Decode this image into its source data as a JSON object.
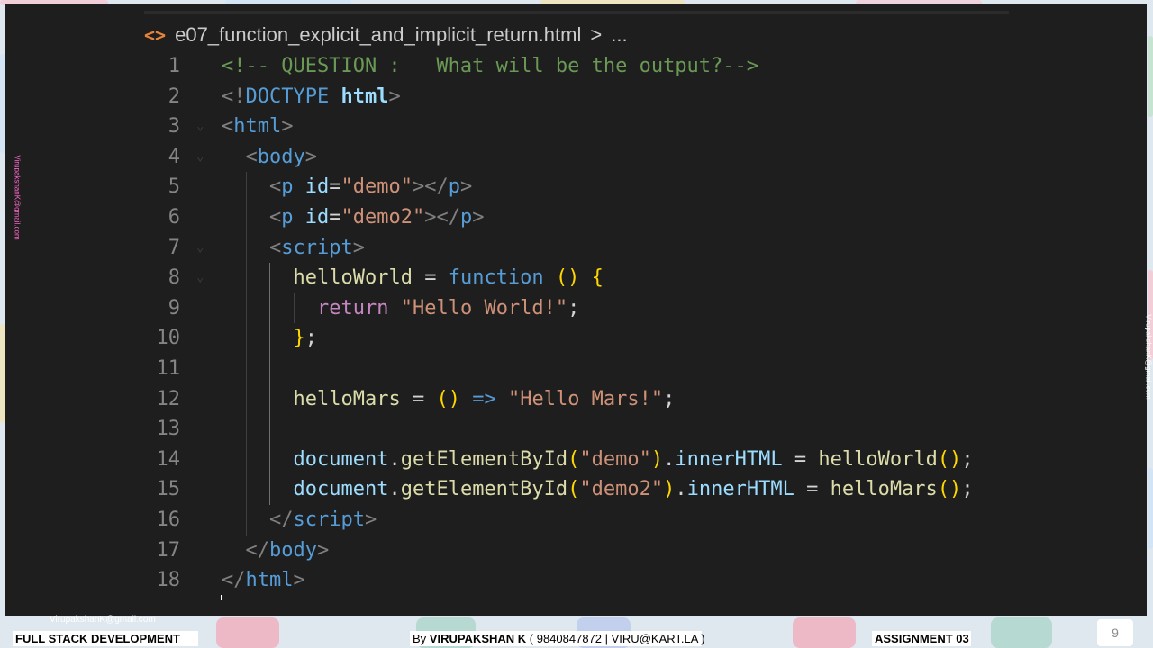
{
  "tab": {
    "file_icon": "<>",
    "filename": "e07_function_explicit_and_implicit_return.html",
    "breadcrumb_sep": ">",
    "breadcrumb_more": "..."
  },
  "editor": {
    "lines": [
      {
        "n": "1",
        "tokens": [
          [
            "t-comment",
            "<!-- QUESTION :   What will be the output?-->"
          ]
        ]
      },
      {
        "n": "2",
        "tokens": [
          [
            "t-punc",
            "<!"
          ],
          [
            "t-tag",
            "DOCTYPE"
          ],
          [
            "t-doctype",
            " "
          ],
          [
            "t-doctype-kw",
            "html"
          ],
          [
            "t-punc",
            ">"
          ]
        ]
      },
      {
        "n": "3",
        "tokens": [
          [
            "t-punc",
            "<"
          ],
          [
            "t-tag",
            "html"
          ],
          [
            "t-punc",
            ">"
          ]
        ]
      },
      {
        "n": "4",
        "tokens": [
          [
            "t-punc",
            "<"
          ],
          [
            "t-tag",
            "body"
          ],
          [
            "t-punc",
            ">"
          ]
        ]
      },
      {
        "n": "5",
        "tokens": [
          [
            "t-punc",
            "<"
          ],
          [
            "t-tag",
            "p"
          ],
          [
            "t-op",
            " "
          ],
          [
            "t-attr",
            "id"
          ],
          [
            "t-op",
            "="
          ],
          [
            "t-str",
            "\"demo\""
          ],
          [
            "t-punc",
            "></"
          ],
          [
            "t-tag",
            "p"
          ],
          [
            "t-punc",
            ">"
          ]
        ]
      },
      {
        "n": "6",
        "tokens": [
          [
            "t-punc",
            "<"
          ],
          [
            "t-tag",
            "p"
          ],
          [
            "t-op",
            " "
          ],
          [
            "t-attr",
            "id"
          ],
          [
            "t-op",
            "="
          ],
          [
            "t-str",
            "\"demo2\""
          ],
          [
            "t-punc",
            "></"
          ],
          [
            "t-tag",
            "p"
          ],
          [
            "t-punc",
            ">"
          ]
        ]
      },
      {
        "n": "7",
        "tokens": [
          [
            "t-punc",
            "<"
          ],
          [
            "t-tag",
            "script"
          ],
          [
            "t-punc",
            ">"
          ]
        ]
      },
      {
        "n": "8",
        "tokens": [
          [
            "t-fn",
            "helloWorld"
          ],
          [
            "t-op",
            " = "
          ],
          [
            "t-kw",
            "function"
          ],
          [
            "t-op",
            " "
          ],
          [
            "t-brace",
            "()"
          ],
          [
            "t-op",
            " "
          ],
          [
            "t-brace",
            "{"
          ]
        ]
      },
      {
        "n": "9",
        "tokens": [
          [
            "t-ctrl",
            "return"
          ],
          [
            "t-op",
            " "
          ],
          [
            "t-str",
            "\"Hello World!\""
          ],
          [
            "t-op",
            ";"
          ]
        ]
      },
      {
        "n": "10",
        "tokens": [
          [
            "t-brace",
            "}"
          ],
          [
            "t-op",
            ";"
          ]
        ]
      },
      {
        "n": "11",
        "tokens": []
      },
      {
        "n": "12",
        "tokens": [
          [
            "t-fn",
            "helloMars"
          ],
          [
            "t-op",
            " = "
          ],
          [
            "t-brace",
            "()"
          ],
          [
            "t-op",
            " "
          ],
          [
            "t-kw",
            "=>"
          ],
          [
            "t-op",
            " "
          ],
          [
            "t-str",
            "\"Hello Mars!\""
          ],
          [
            "t-op",
            ";"
          ]
        ]
      },
      {
        "n": "13",
        "tokens": []
      },
      {
        "n": "14",
        "tokens": [
          [
            "t-prop",
            "document"
          ],
          [
            "t-op",
            "."
          ],
          [
            "t-fn",
            "getElementById"
          ],
          [
            "t-brace",
            "("
          ],
          [
            "t-str",
            "\"demo\""
          ],
          [
            "t-brace",
            ")"
          ],
          [
            "t-op",
            "."
          ],
          [
            "t-prop",
            "innerHTML"
          ],
          [
            "t-op",
            " = "
          ],
          [
            "t-fn",
            "helloWorld"
          ],
          [
            "t-brace",
            "()"
          ],
          [
            "t-op",
            ";"
          ]
        ]
      },
      {
        "n": "15",
        "tokens": [
          [
            "t-prop",
            "document"
          ],
          [
            "t-op",
            "."
          ],
          [
            "t-fn",
            "getElementById"
          ],
          [
            "t-brace",
            "("
          ],
          [
            "t-str",
            "\"demo2\""
          ],
          [
            "t-brace",
            ")"
          ],
          [
            "t-op",
            "."
          ],
          [
            "t-prop",
            "innerHTML"
          ],
          [
            "t-op",
            " = "
          ],
          [
            "t-fn",
            "helloMars"
          ],
          [
            "t-brace",
            "()"
          ],
          [
            "t-op",
            ";"
          ]
        ]
      },
      {
        "n": "16",
        "tokens": [
          [
            "t-punc",
            "</"
          ],
          [
            "t-tag",
            "script"
          ],
          [
            "t-punc",
            ">"
          ]
        ]
      },
      {
        "n": "17",
        "tokens": [
          [
            "t-punc",
            "</"
          ],
          [
            "t-tag",
            "body"
          ],
          [
            "t-punc",
            ">"
          ]
        ]
      },
      {
        "n": "18",
        "tokens": [
          [
            "t-punc",
            "</"
          ],
          [
            "t-tag",
            "html"
          ],
          [
            "t-punc",
            ">"
          ]
        ]
      }
    ]
  },
  "slide": {
    "email_bottom": "VirupakshanK@gmail.com",
    "email_side_left": "VirupakshanK@gmail.com",
    "email_side_right": "VirupakshanK@gmail.com",
    "course": "FULL STACK DEVELOPMENT",
    "by_prefix": "By ",
    "author": "VIRUPAKSHAN K",
    "contact": " ( 9840847872 | VIRU@KART.LA )",
    "assignment": "ASSIGNMENT 03",
    "page_number": "9"
  }
}
